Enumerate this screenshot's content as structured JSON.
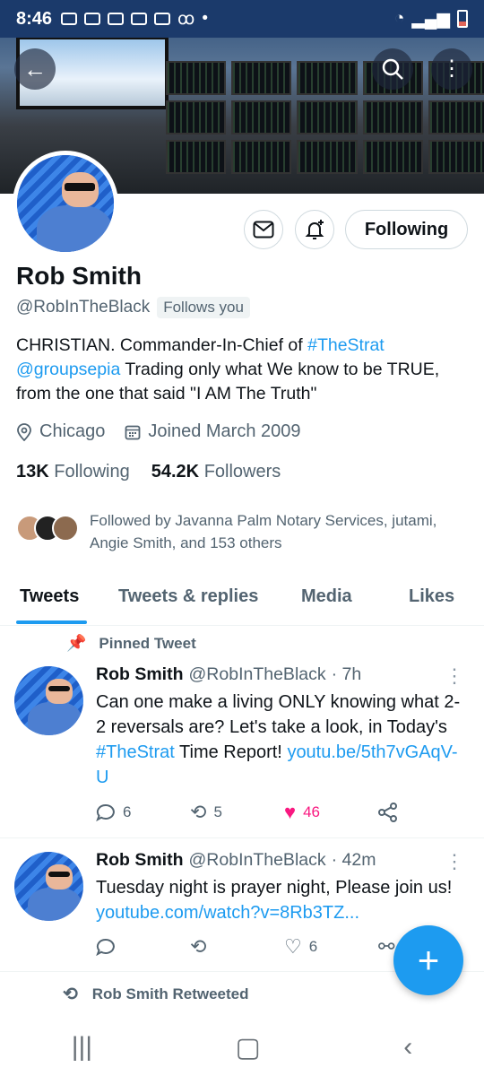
{
  "status_bar": {
    "time": "8:46"
  },
  "profile": {
    "name": "Rob Smith",
    "handle": "@RobInTheBlack",
    "follows_you": "Follows you",
    "bio_1": "CHRISTIAN. Commander-In-Chief of ",
    "bio_hashtag": "#TheStrat",
    "bio_mention": "@groupsepia",
    "bio_2": " Trading only what We know to be TRUE, from the one that said \"I AM The Truth\"",
    "location": "Chicago",
    "joined": "Joined March 2009",
    "following_count": "13K",
    "following_label": "Following",
    "followers_count": "54.2K",
    "followers_label": "Followers",
    "followed_by": "Followed by Javanna Palm Notary Services, jutami, Angie Smith, and 153 others",
    "follow_button": "Following"
  },
  "tabs": [
    "Tweets",
    "Tweets & replies",
    "Media",
    "Likes"
  ],
  "tweets": [
    {
      "pinned_label": "Pinned Tweet",
      "name": "Rob Smith",
      "handle": "@RobInTheBlack",
      "time": "· 7h",
      "text_1": "Can one make a living ONLY knowing what 2-2 reversals are? Let's take a look, in Today's ",
      "hashtag": "#TheStrat",
      "text_2": " Time Report! ",
      "link": "youtu.be/5th7vGAqV-U",
      "replies": "6",
      "retweets": "5",
      "likes": "46"
    },
    {
      "name": "Rob Smith",
      "handle": "@RobInTheBlack",
      "time": "· 42m",
      "text_1": "Tuesday night is prayer night, Please join us! ",
      "link": "youtube.com/watch?v=8Rb3TZ...",
      "replies": "",
      "retweets": "",
      "likes": "6"
    }
  ],
  "retweeted_label": "Rob Smith Retweeted",
  "colors": {
    "accent": "#1d9bf0",
    "like": "#f91880",
    "text": "#0f1419",
    "muted": "#536471"
  }
}
